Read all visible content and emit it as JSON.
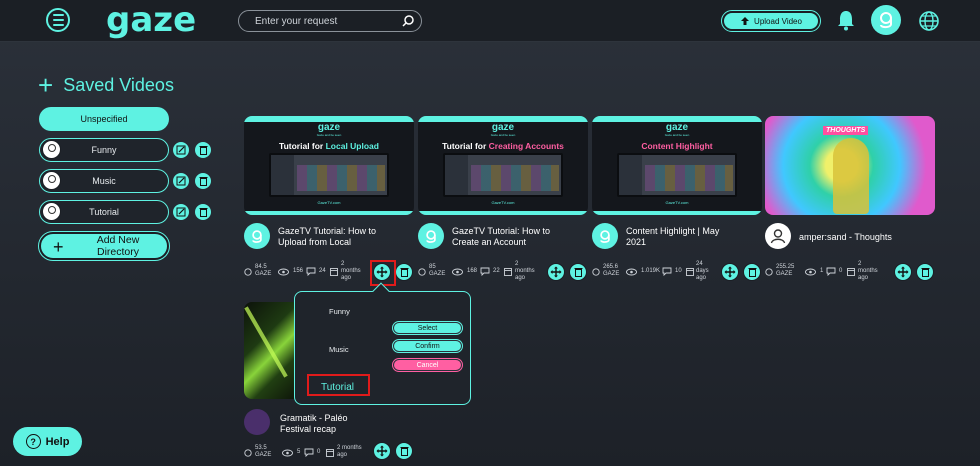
{
  "header": {
    "logo": "gaze",
    "search_placeholder": "Enter your request",
    "upload_label": "Upload Video"
  },
  "sidebar": {
    "title": "Saved Videos",
    "directories": [
      {
        "label": "Unspecified"
      },
      {
        "label": "Funny"
      },
      {
        "label": "Music"
      },
      {
        "label": "Tutorial"
      }
    ],
    "add_directory_line1": "Add New",
    "add_directory_line2": "Directory"
  },
  "videos": [
    {
      "thumb_logo": "gaze",
      "thumb_sub": "Gaze and be seen",
      "thumb_title_pre": "Tutorial for ",
      "thumb_title_hl": "Local Upload",
      "thumb_url": "GazeTV.com",
      "title_line1": "GazeTV Tutorial: How to",
      "title_line2": "Upload from Local",
      "gaze": "84.5",
      "gaze_unit": "GAZE",
      "views": "156",
      "comments": "24",
      "age_line1": "2",
      "age_line2": "months",
      "age_line3": "ago"
    },
    {
      "thumb_logo": "gaze",
      "thumb_sub": "Gaze and be seen",
      "thumb_title_pre": "Tutorial for ",
      "thumb_title_hl": "Creating Accounts",
      "thumb_url": "GazeTV.com",
      "title_line1": "GazeTV Tutorial: How to",
      "title_line2": "Create an Account",
      "gaze": "85",
      "gaze_unit": "GAZE",
      "views": "168",
      "comments": "22",
      "age_line1": "2",
      "age_line2": "months",
      "age_line3": "ago"
    },
    {
      "thumb_logo": "gaze",
      "thumb_sub": "Gaze and be seen",
      "thumb_title_pre": "",
      "thumb_title_hl": "Content Highlight",
      "thumb_url": "GazeTV.com",
      "title_line1": "Content Highlight | May",
      "title_line2": "2021",
      "gaze": "265.6",
      "gaze_unit": "GAZE",
      "views": "1.019K",
      "comments": "10",
      "age_line1": "24",
      "age_line2": "days",
      "age_line3": "ago"
    },
    {
      "thumb_badge": "THOUGHTS",
      "title_line1": "amper:sand - Thoughts",
      "title_line2": "",
      "gaze": "255.25",
      "gaze_unit": "GAZE",
      "views": "1",
      "comments": "0",
      "age_line1": "2",
      "age_line2": "months",
      "age_line3": "ago"
    },
    {
      "title_line1": "Gramatik - Paléo",
      "title_line2": "Festival recap",
      "gaze": "53.5",
      "gaze_unit": "GAZE",
      "views": "5",
      "comments": "0",
      "age_line1": "2 months",
      "age_line2": "ago",
      "age_line3": ""
    }
  ],
  "move_popup": {
    "options": [
      {
        "label": "Funny"
      },
      {
        "label": "Music"
      },
      {
        "label": "Tutorial"
      }
    ],
    "select_label": "Select",
    "confirm_label": "Confirm",
    "cancel_label": "Cancel"
  },
  "help_label": "Help",
  "colors": {
    "accent": "#5ef2e2",
    "danger": "#ff5fa2",
    "highlight": "#e01b1b"
  }
}
